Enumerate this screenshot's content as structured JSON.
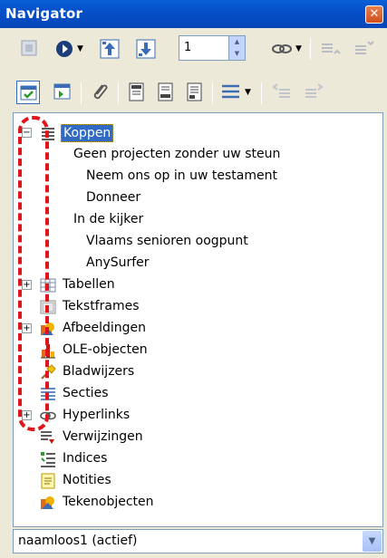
{
  "window": {
    "title": "Navigator",
    "close_glyph": "✕"
  },
  "toolbar1": {
    "buttons": [
      {
        "icon": "content-view-icon"
      },
      {
        "icon": "navigation-icon"
      },
      {
        "icon": "previous-icon"
      },
      {
        "icon": "next-icon"
      },
      {
        "icon": "drag-mode-icon"
      },
      {
        "icon": "promote-level-icon"
      },
      {
        "icon": "demote-level-icon"
      }
    ],
    "page_number": "1"
  },
  "toolbar2": {
    "buttons": [
      {
        "icon": "toggle-icon"
      },
      {
        "icon": "templates-icon"
      },
      {
        "icon": "reminder-icon"
      },
      {
        "icon": "header-icon"
      },
      {
        "icon": "footer-icon"
      },
      {
        "icon": "anchor-text-icon"
      },
      {
        "icon": "heading-levels-icon"
      },
      {
        "icon": "promote-chapter-icon"
      },
      {
        "icon": "demote-chapter-icon"
      }
    ]
  },
  "tree": {
    "items": [
      {
        "label": "Koppen",
        "icon": "headings-icon",
        "expander": "−",
        "selected": true
      },
      {
        "label": "Geen projecten zonder uw steun",
        "level": 1
      },
      {
        "label": "Neem ons op in uw testament",
        "level": 2
      },
      {
        "label": "Donneer",
        "level": 2
      },
      {
        "label": "In de kijker",
        "level": 1
      },
      {
        "label": "Vlaams senioren oogpunt",
        "level": 2
      },
      {
        "label": "AnySurfer",
        "level": 2
      },
      {
        "label": "Tabellen",
        "icon": "table-icon",
        "expander": "+"
      },
      {
        "label": "Tekstframes",
        "icon": "frame-icon"
      },
      {
        "label": "Afbeeldingen",
        "icon": "image-icon",
        "expander": "+"
      },
      {
        "label": "OLE-objecten",
        "icon": "chart-icon"
      },
      {
        "label": "Bladwijzers",
        "icon": "bookmark-icon"
      },
      {
        "label": "Secties",
        "icon": "section-icon"
      },
      {
        "label": "Hyperlinks",
        "icon": "link-icon",
        "expander": "+"
      },
      {
        "label": "Verwijzingen",
        "icon": "reference-icon"
      },
      {
        "label": "Indices",
        "icon": "index-icon"
      },
      {
        "label": "Notities",
        "icon": "note-icon"
      },
      {
        "label": "Tekenobjecten",
        "icon": "drawing-icon"
      }
    ]
  },
  "document_select": {
    "value": "naamloos1 (actief)"
  },
  "colors": {
    "selection": "#316ac5",
    "annotation": "#e0141a",
    "titlebar": "#0550c8"
  }
}
